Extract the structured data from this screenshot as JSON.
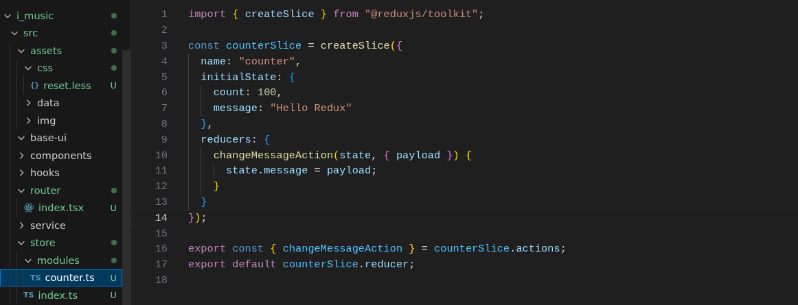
{
  "explorer": {
    "tree": [
      {
        "name": "i_music",
        "kind": "folder",
        "expanded": true,
        "untracked": true,
        "dot": true,
        "selected": false,
        "children": [
          {
            "name": "src",
            "kind": "folder",
            "expanded": true,
            "untracked": true,
            "dot": true,
            "selected": false,
            "children": [
              {
                "name": "assets",
                "kind": "folder",
                "expanded": true,
                "untracked": true,
                "dot": true,
                "selected": false,
                "children": [
                  {
                    "name": "css",
                    "kind": "folder",
                    "expanded": true,
                    "untracked": true,
                    "dot": true,
                    "selected": false,
                    "children": [
                      {
                        "name": "reset.less",
                        "kind": "less",
                        "icon_glyph": "{}",
                        "untracked": true,
                        "badge": "U",
                        "selected": false
                      }
                    ]
                  },
                  {
                    "name": "data",
                    "kind": "folder",
                    "expanded": false,
                    "untracked": false,
                    "dot": false,
                    "selected": false
                  },
                  {
                    "name": "img",
                    "kind": "folder",
                    "expanded": false,
                    "untracked": false,
                    "dot": false,
                    "selected": false
                  }
                ]
              },
              {
                "name": "base-ui",
                "kind": "folder",
                "expanded": true,
                "untracked": false,
                "dot": false,
                "selected": false
              },
              {
                "name": "components",
                "kind": "folder",
                "expanded": false,
                "untracked": false,
                "dot": false,
                "selected": false
              },
              {
                "name": "hooks",
                "kind": "folder",
                "expanded": false,
                "untracked": false,
                "dot": false,
                "selected": false
              },
              {
                "name": "router",
                "kind": "folder",
                "expanded": true,
                "untracked": true,
                "dot": true,
                "selected": false,
                "children": [
                  {
                    "name": "index.tsx",
                    "kind": "react",
                    "untracked": true,
                    "badge": "U",
                    "selected": false
                  }
                ]
              },
              {
                "name": "service",
                "kind": "folder",
                "expanded": false,
                "untracked": false,
                "dot": false,
                "selected": false
              },
              {
                "name": "store",
                "kind": "folder",
                "expanded": true,
                "untracked": true,
                "dot": true,
                "selected": false,
                "children": [
                  {
                    "name": "modules",
                    "kind": "folder",
                    "expanded": true,
                    "untracked": true,
                    "dot": true,
                    "selected": false,
                    "children": [
                      {
                        "name": "counter.ts",
                        "kind": "ts",
                        "icon_glyph": "TS",
                        "untracked": true,
                        "badge": "U",
                        "selected": true
                      }
                    ]
                  },
                  {
                    "name": "index.ts",
                    "kind": "ts",
                    "icon_glyph": "TS",
                    "untracked": true,
                    "badge": "U",
                    "selected": false
                  }
                ]
              }
            ]
          }
        ]
      }
    ]
  },
  "editor": {
    "lines": [
      {
        "number": "1",
        "current": false,
        "tokens": [
          {
            "kind": "ctl",
            "text": "import "
          },
          {
            "kind": "b1",
            "text": "{ "
          },
          {
            "kind": "prop",
            "text": "createSlice "
          },
          {
            "kind": "b1",
            "text": "} "
          },
          {
            "kind": "ctl",
            "text": "from "
          },
          {
            "kind": "str",
            "text": "\"@reduxjs/toolkit\""
          },
          {
            "kind": "p",
            "text": ";"
          }
        ]
      },
      {
        "number": "2",
        "current": false
      },
      {
        "number": "3",
        "current": false,
        "tokens": [
          {
            "kind": "kw",
            "text": "const "
          },
          {
            "kind": "var",
            "text": "counterSlice"
          },
          {
            "kind": "p",
            "text": " = "
          },
          {
            "kind": "fn",
            "text": "createSlice"
          },
          {
            "kind": "b1",
            "text": "("
          },
          {
            "kind": "b2",
            "text": "{"
          }
        ],
        "children": [
          {
            "number": "4",
            "current": false,
            "tokens": [
              {
                "kind": "prop",
                "text": "name"
              },
              {
                "kind": "p",
                "text": ": "
              },
              {
                "kind": "str",
                "text": "\"counter\""
              },
              {
                "kind": "p",
                "text": ","
              }
            ]
          },
          {
            "number": "5",
            "current": false,
            "tokens": [
              {
                "kind": "prop",
                "text": "initialState"
              },
              {
                "kind": "p",
                "text": ": "
              },
              {
                "kind": "b3",
                "text": "{"
              }
            ],
            "children": [
              {
                "number": "6",
                "current": false,
                "tokens": [
                  {
                    "kind": "prop",
                    "text": "count"
                  },
                  {
                    "kind": "p",
                    "text": ": "
                  },
                  {
                    "kind": "num",
                    "text": "100"
                  },
                  {
                    "kind": "p",
                    "text": ","
                  }
                ]
              },
              {
                "number": "7",
                "current": false,
                "tokens": [
                  {
                    "kind": "prop",
                    "text": "message"
                  },
                  {
                    "kind": "p",
                    "text": ": "
                  },
                  {
                    "kind": "str",
                    "text": "\"Hello Redux\""
                  }
                ]
              }
            ]
          },
          {
            "number": "8",
            "current": false,
            "tokens": [
              {
                "kind": "b3",
                "text": "}"
              },
              {
                "kind": "p",
                "text": ","
              }
            ]
          },
          {
            "number": "9",
            "current": false,
            "tokens": [
              {
                "kind": "prop",
                "text": "reducers"
              },
              {
                "kind": "p",
                "text": ": "
              },
              {
                "kind": "b3",
                "text": "{"
              }
            ],
            "children": [
              {
                "number": "10",
                "current": false,
                "tokens": [
                  {
                    "kind": "fn",
                    "text": "changeMessageAction"
                  },
                  {
                    "kind": "b1",
                    "text": "("
                  },
                  {
                    "kind": "prop",
                    "text": "state"
                  },
                  {
                    "kind": "p",
                    "text": ", "
                  },
                  {
                    "kind": "b2",
                    "text": "{ "
                  },
                  {
                    "kind": "prop",
                    "text": "payload "
                  },
                  {
                    "kind": "b2",
                    "text": "}"
                  },
                  {
                    "kind": "b1",
                    "text": ") {"
                  }
                ],
                "children": [
                  {
                    "number": "11",
                    "current": false,
                    "tokens": [
                      {
                        "kind": "prop",
                        "text": "state"
                      },
                      {
                        "kind": "p",
                        "text": "."
                      },
                      {
                        "kind": "prop",
                        "text": "message"
                      },
                      {
                        "kind": "p",
                        "text": " = "
                      },
                      {
                        "kind": "prop",
                        "text": "payload"
                      },
                      {
                        "kind": "p",
                        "text": ";"
                      }
                    ]
                  }
                ]
              },
              {
                "number": "12",
                "current": false,
                "tokens": [
                  {
                    "kind": "b1",
                    "text": "}"
                  }
                ]
              }
            ]
          },
          {
            "number": "13",
            "current": false,
            "tokens": [
              {
                "kind": "b3",
                "text": "}"
              }
            ]
          }
        ]
      },
      {
        "number": "14",
        "current": true,
        "tokens": [
          {
            "kind": "b2",
            "text": "}"
          },
          {
            "kind": "b1",
            "text": ")"
          },
          {
            "kind": "p",
            "text": ";"
          }
        ]
      },
      {
        "number": "15",
        "current": false
      },
      {
        "number": "16",
        "current": false,
        "tokens": [
          {
            "kind": "ctl",
            "text": "export "
          },
          {
            "kind": "kw",
            "text": "const "
          },
          {
            "kind": "b1",
            "text": "{ "
          },
          {
            "kind": "var",
            "text": "changeMessageAction "
          },
          {
            "kind": "b1",
            "text": "}"
          },
          {
            "kind": "p",
            "text": " = "
          },
          {
            "kind": "var",
            "text": "counterSlice"
          },
          {
            "kind": "p",
            "text": "."
          },
          {
            "kind": "prop",
            "text": "actions"
          },
          {
            "kind": "p",
            "text": ";"
          }
        ]
      },
      {
        "number": "17",
        "current": false,
        "tokens": [
          {
            "kind": "ctl",
            "text": "export default "
          },
          {
            "kind": "var",
            "text": "counterSlice"
          },
          {
            "kind": "p",
            "text": "."
          },
          {
            "kind": "prop",
            "text": "reducer"
          },
          {
            "kind": "p",
            "text": ";"
          }
        ]
      },
      {
        "number": "18",
        "current": false
      }
    ]
  }
}
